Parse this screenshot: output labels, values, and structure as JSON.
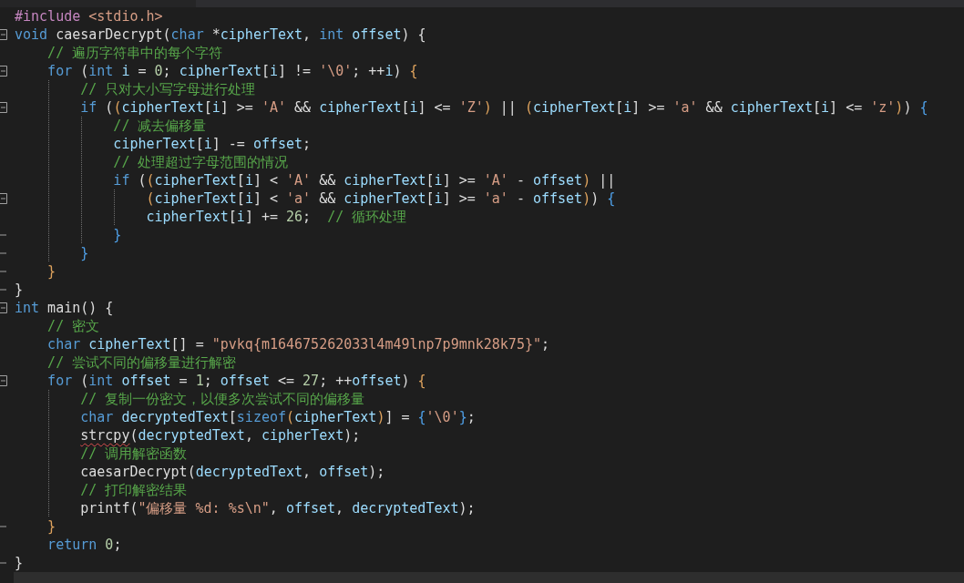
{
  "editor": {
    "lines": [
      {
        "kind": "plain",
        "tokens": [
          {
            "kind": "directive",
            "text": "#include"
          },
          {
            "kind": "header",
            "text": " <stdio.h>"
          }
        ]
      },
      {
        "kind": "fold-start",
        "tokens": [
          {
            "kind": "keyword",
            "text": "void"
          },
          {
            "kind": "function",
            "text": " caesarDecrypt"
          },
          {
            "kind": "punct",
            "text": "("
          },
          {
            "kind": "keyword",
            "text": "char"
          },
          {
            "kind": "punct",
            "text": " *"
          },
          {
            "kind": "variable",
            "text": "cipherText"
          },
          {
            "kind": "punct",
            "text": ", "
          },
          {
            "kind": "keyword",
            "text": "int"
          },
          {
            "kind": "variable",
            "text": " offset"
          },
          {
            "kind": "punct",
            "text": ") {"
          }
        ]
      },
      {
        "kind": "plain",
        "tokens": [
          {
            "kind": "comment",
            "text": "    // 遍历字符串中的每个字符"
          }
        ]
      },
      {
        "kind": "fold-start",
        "tokens": [
          {
            "kind": "keyword",
            "text": "    for"
          },
          {
            "kind": "punct",
            "text": " ("
          },
          {
            "kind": "keyword",
            "text": "int"
          },
          {
            "kind": "variable",
            "text": " i"
          },
          {
            "kind": "punct",
            "text": " = "
          },
          {
            "kind": "number",
            "text": "0"
          },
          {
            "kind": "punct",
            "text": "; "
          },
          {
            "kind": "variable",
            "text": "cipherText"
          },
          {
            "kind": "punct",
            "text": "["
          },
          {
            "kind": "variable",
            "text": "i"
          },
          {
            "kind": "punct",
            "text": "] != "
          },
          {
            "kind": "string",
            "text": "'\\0'"
          },
          {
            "kind": "punct",
            "text": "; ++"
          },
          {
            "kind": "variable",
            "text": "i"
          },
          {
            "kind": "punct",
            "text": ") "
          },
          {
            "kind": "bracket-1",
            "text": "{"
          }
        ]
      },
      {
        "kind": "plain",
        "tokens": [
          {
            "kind": "comment",
            "text": "        // 只对大小写字母进行处理"
          }
        ]
      },
      {
        "kind": "fold-start",
        "tokens": [
          {
            "kind": "keyword",
            "text": "        if"
          },
          {
            "kind": "punct",
            "text": " ("
          },
          {
            "kind": "bracket-1",
            "text": "("
          },
          {
            "kind": "variable",
            "text": "cipherText"
          },
          {
            "kind": "punct",
            "text": "["
          },
          {
            "kind": "variable",
            "text": "i"
          },
          {
            "kind": "punct",
            "text": "] >= "
          },
          {
            "kind": "string",
            "text": "'A'"
          },
          {
            "kind": "punct",
            "text": " && "
          },
          {
            "kind": "variable",
            "text": "cipherText"
          },
          {
            "kind": "punct",
            "text": "["
          },
          {
            "kind": "variable",
            "text": "i"
          },
          {
            "kind": "punct",
            "text": "] <= "
          },
          {
            "kind": "string",
            "text": "'Z'"
          },
          {
            "kind": "bracket-1",
            "text": ")"
          },
          {
            "kind": "punct",
            "text": " || "
          },
          {
            "kind": "bracket-1",
            "text": "("
          },
          {
            "kind": "variable",
            "text": "cipherText"
          },
          {
            "kind": "punct",
            "text": "["
          },
          {
            "kind": "variable",
            "text": "i"
          },
          {
            "kind": "punct",
            "text": "] >= "
          },
          {
            "kind": "string",
            "text": "'a'"
          },
          {
            "kind": "punct",
            "text": " && "
          },
          {
            "kind": "variable",
            "text": "cipherText"
          },
          {
            "kind": "punct",
            "text": "["
          },
          {
            "kind": "variable",
            "text": "i"
          },
          {
            "kind": "punct",
            "text": "] <= "
          },
          {
            "kind": "string",
            "text": "'z'"
          },
          {
            "kind": "bracket-1",
            "text": ")"
          },
          {
            "kind": "punct",
            "text": ") "
          },
          {
            "kind": "bracket-2",
            "text": "{"
          }
        ]
      },
      {
        "kind": "plain",
        "tokens": [
          {
            "kind": "comment",
            "text": "            // 减去偏移量"
          }
        ]
      },
      {
        "kind": "plain",
        "tokens": [
          {
            "kind": "variable",
            "text": "            cipherText"
          },
          {
            "kind": "punct",
            "text": "["
          },
          {
            "kind": "variable",
            "text": "i"
          },
          {
            "kind": "punct",
            "text": "] -= "
          },
          {
            "kind": "variable",
            "text": "offset"
          },
          {
            "kind": "punct",
            "text": ";"
          }
        ]
      },
      {
        "kind": "plain",
        "tokens": [
          {
            "kind": "comment",
            "text": "            // 处理超过字母范围的情况"
          }
        ]
      },
      {
        "kind": "plain",
        "tokens": [
          {
            "kind": "keyword",
            "text": "            if"
          },
          {
            "kind": "punct",
            "text": " ("
          },
          {
            "kind": "bracket-1",
            "text": "("
          },
          {
            "kind": "variable",
            "text": "cipherText"
          },
          {
            "kind": "punct",
            "text": "["
          },
          {
            "kind": "variable",
            "text": "i"
          },
          {
            "kind": "punct",
            "text": "] < "
          },
          {
            "kind": "string",
            "text": "'A'"
          },
          {
            "kind": "punct",
            "text": " && "
          },
          {
            "kind": "variable",
            "text": "cipherText"
          },
          {
            "kind": "punct",
            "text": "["
          },
          {
            "kind": "variable",
            "text": "i"
          },
          {
            "kind": "punct",
            "text": "] >= "
          },
          {
            "kind": "string",
            "text": "'A'"
          },
          {
            "kind": "punct",
            "text": " - "
          },
          {
            "kind": "variable",
            "text": "offset"
          },
          {
            "kind": "bracket-1",
            "text": ")"
          },
          {
            "kind": "punct",
            "text": " ||"
          }
        ]
      },
      {
        "kind": "fold-start",
        "tokens": [
          {
            "kind": "bracket-1",
            "text": "                ("
          },
          {
            "kind": "variable",
            "text": "cipherText"
          },
          {
            "kind": "punct",
            "text": "["
          },
          {
            "kind": "variable",
            "text": "i"
          },
          {
            "kind": "punct",
            "text": "] < "
          },
          {
            "kind": "string",
            "text": "'a'"
          },
          {
            "kind": "punct",
            "text": " && "
          },
          {
            "kind": "variable",
            "text": "cipherText"
          },
          {
            "kind": "punct",
            "text": "["
          },
          {
            "kind": "variable",
            "text": "i"
          },
          {
            "kind": "punct",
            "text": "] >= "
          },
          {
            "kind": "string",
            "text": "'a'"
          },
          {
            "kind": "punct",
            "text": " - "
          },
          {
            "kind": "variable",
            "text": "offset"
          },
          {
            "kind": "bracket-1",
            "text": ")"
          },
          {
            "kind": "punct",
            "text": ") "
          },
          {
            "kind": "bracket-2",
            "text": "{"
          }
        ]
      },
      {
        "kind": "plain",
        "tokens": [
          {
            "kind": "variable",
            "text": "                cipherText"
          },
          {
            "kind": "punct",
            "text": "["
          },
          {
            "kind": "variable",
            "text": "i"
          },
          {
            "kind": "punct",
            "text": "] += "
          },
          {
            "kind": "number",
            "text": "26"
          },
          {
            "kind": "punct",
            "text": ";  "
          },
          {
            "kind": "comment",
            "text": "// 循环处理"
          }
        ]
      },
      {
        "kind": "fold-end",
        "tokens": [
          {
            "kind": "bracket-2",
            "text": "            }"
          }
        ]
      },
      {
        "kind": "fold-end",
        "tokens": [
          {
            "kind": "bracket-2",
            "text": "        }"
          }
        ]
      },
      {
        "kind": "fold-end",
        "tokens": [
          {
            "kind": "bracket-1",
            "text": "    }"
          }
        ]
      },
      {
        "kind": "fold-end",
        "tokens": [
          {
            "kind": "punct",
            "text": "}"
          }
        ]
      },
      {
        "kind": "fold-start",
        "tokens": [
          {
            "kind": "keyword",
            "text": "int"
          },
          {
            "kind": "function",
            "text": " main"
          },
          {
            "kind": "punct",
            "text": "() {"
          }
        ]
      },
      {
        "kind": "plain",
        "tokens": [
          {
            "kind": "comment",
            "text": "    // 密文"
          }
        ]
      },
      {
        "kind": "plain",
        "tokens": [
          {
            "kind": "keyword",
            "text": "    char"
          },
          {
            "kind": "variable",
            "text": " cipherText"
          },
          {
            "kind": "punct",
            "text": "[] = "
          },
          {
            "kind": "string",
            "text": "\"pvkq{m164675262033l4m49lnp7p9mnk28k75}\""
          },
          {
            "kind": "punct",
            "text": ";"
          }
        ]
      },
      {
        "kind": "plain",
        "tokens": [
          {
            "kind": "comment",
            "text": "    // 尝试不同的偏移量进行解密"
          }
        ]
      },
      {
        "kind": "fold-start",
        "tokens": [
          {
            "kind": "keyword",
            "text": "    for"
          },
          {
            "kind": "punct",
            "text": " ("
          },
          {
            "kind": "keyword",
            "text": "int"
          },
          {
            "kind": "variable",
            "text": " offset"
          },
          {
            "kind": "punct",
            "text": " = "
          },
          {
            "kind": "number",
            "text": "1"
          },
          {
            "kind": "punct",
            "text": "; "
          },
          {
            "kind": "variable",
            "text": "offset"
          },
          {
            "kind": "punct",
            "text": " <= "
          },
          {
            "kind": "number",
            "text": "27"
          },
          {
            "kind": "punct",
            "text": "; ++"
          },
          {
            "kind": "variable",
            "text": "offset"
          },
          {
            "kind": "punct",
            "text": ") "
          },
          {
            "kind": "bracket-1",
            "text": "{"
          }
        ]
      },
      {
        "kind": "plain",
        "tokens": [
          {
            "kind": "comment",
            "text": "        // 复制一份密文，以便多次尝试不同的偏移量"
          }
        ]
      },
      {
        "kind": "plain",
        "tokens": [
          {
            "kind": "keyword",
            "text": "        char"
          },
          {
            "kind": "variable",
            "text": " decryptedText"
          },
          {
            "kind": "punct",
            "text": "["
          },
          {
            "kind": "keyword",
            "text": "sizeof"
          },
          {
            "kind": "bracket-1",
            "text": "("
          },
          {
            "kind": "variable",
            "text": "cipherText"
          },
          {
            "kind": "bracket-1",
            "text": ")"
          },
          {
            "kind": "punct",
            "text": "] = "
          },
          {
            "kind": "bracket-2",
            "text": "{"
          },
          {
            "kind": "string",
            "text": "'\\0'"
          },
          {
            "kind": "bracket-2",
            "text": "}"
          },
          {
            "kind": "punct",
            "text": ";"
          }
        ]
      },
      {
        "kind": "plain",
        "tokens": [
          {
            "kind": "function",
            "text": "        strcpy",
            "misspelled": true
          },
          {
            "kind": "punct",
            "text": "("
          },
          {
            "kind": "variable",
            "text": "decryptedText"
          },
          {
            "kind": "punct",
            "text": ", "
          },
          {
            "kind": "variable",
            "text": "cipherText"
          },
          {
            "kind": "punct",
            "text": ");"
          }
        ]
      },
      {
        "kind": "plain",
        "tokens": [
          {
            "kind": "comment",
            "text": "        // 调用解密函数"
          }
        ]
      },
      {
        "kind": "plain",
        "tokens": [
          {
            "kind": "function",
            "text": "        caesarDecrypt"
          },
          {
            "kind": "punct",
            "text": "("
          },
          {
            "kind": "variable",
            "text": "decryptedText"
          },
          {
            "kind": "punct",
            "text": ", "
          },
          {
            "kind": "variable",
            "text": "offset"
          },
          {
            "kind": "punct",
            "text": ");"
          }
        ]
      },
      {
        "kind": "plain",
        "tokens": [
          {
            "kind": "comment",
            "text": "        // 打印解密结果"
          }
        ]
      },
      {
        "kind": "plain",
        "tokens": [
          {
            "kind": "function",
            "text": "        printf"
          },
          {
            "kind": "punct",
            "text": "("
          },
          {
            "kind": "string",
            "text": "\"偏移量 %d: %s\\n\""
          },
          {
            "kind": "punct",
            "text": ", "
          },
          {
            "kind": "variable",
            "text": "offset"
          },
          {
            "kind": "punct",
            "text": ", "
          },
          {
            "kind": "variable",
            "text": "decryptedText"
          },
          {
            "kind": "punct",
            "text": ");"
          }
        ]
      },
      {
        "kind": "fold-end",
        "tokens": [
          {
            "kind": "bracket-1",
            "text": "    }"
          }
        ]
      },
      {
        "kind": "plain",
        "tokens": [
          {
            "kind": "keyword",
            "text": "    return"
          },
          {
            "kind": "number",
            "text": " 0"
          },
          {
            "kind": "punct",
            "text": ";"
          }
        ]
      },
      {
        "kind": "fold-end",
        "tokens": [
          {
            "kind": "punct",
            "text": "}"
          }
        ]
      }
    ]
  }
}
